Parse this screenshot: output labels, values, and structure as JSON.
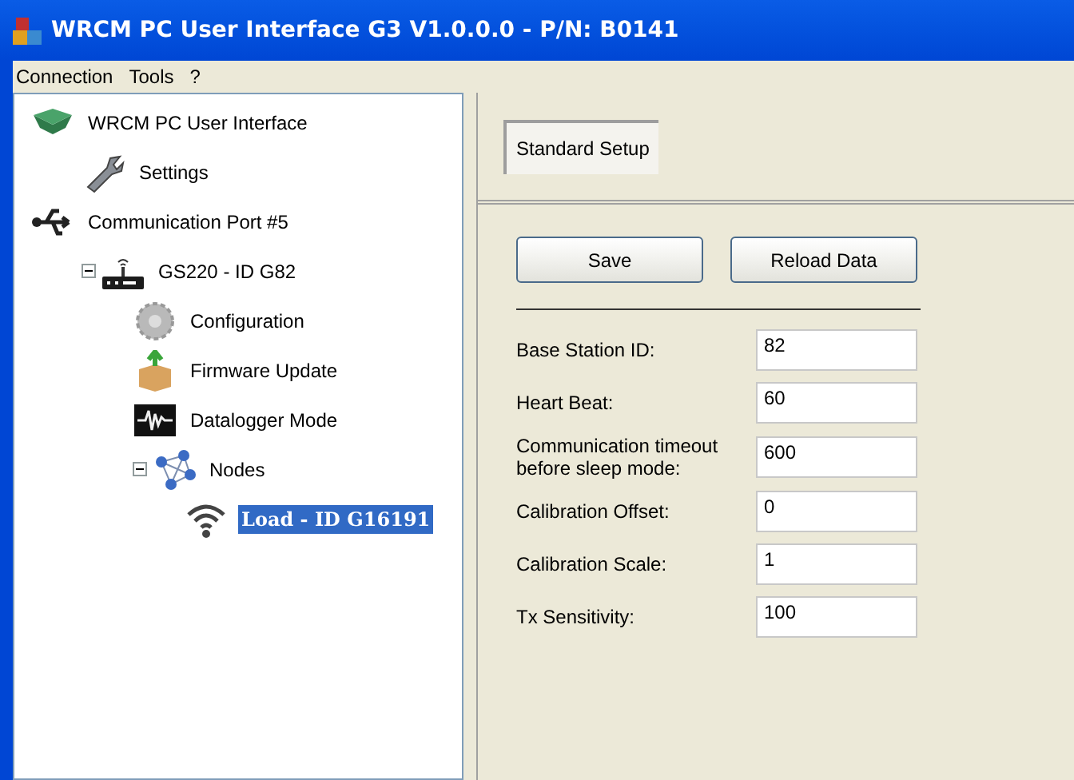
{
  "window": {
    "title": "WRCM PC User Interface G3 V1.0.0.0 - P/N: B0141"
  },
  "menu": [
    "Connection",
    "Tools",
    "?"
  ],
  "tree": [
    {
      "label": "WRCM PC User Interface",
      "kind": "app",
      "selected": false,
      "children": [
        {
          "label": "Settings",
          "kind": "wrench",
          "selected": false
        }
      ]
    },
    {
      "label": "Communication Port #5",
      "kind": "usb",
      "selected": false,
      "children": [
        {
          "label": "GS220 - ID G82",
          "kind": "router",
          "selected": false,
          "expanded": true,
          "children": [
            {
              "label": "Configuration",
              "kind": "gear",
              "selected": false
            },
            {
              "label": "Firmware Update",
              "kind": "box",
              "selected": false
            },
            {
              "label": "Datalogger Mode",
              "kind": "waveform",
              "selected": false
            },
            {
              "label": "Nodes",
              "kind": "network",
              "selected": false,
              "expanded": true,
              "children": [
                {
                  "label": "Load - ID G16191",
                  "kind": "wifi",
                  "selected": true
                }
              ]
            }
          ]
        }
      ]
    }
  ],
  "tabs": [
    {
      "label": "Standard Setup",
      "selected": true
    }
  ],
  "buttons": [
    "Save",
    "Reload Data"
  ],
  "fields": [
    {
      "label": "Base Station ID:",
      "value": "82"
    },
    {
      "label": "Heart Beat:",
      "value": "60"
    },
    {
      "label": "Communication timeout before sleep mode:",
      "value": "600"
    },
    {
      "label": "Calibration Offset:",
      "value": "0"
    },
    {
      "label": "Calibration Scale:",
      "value": "1"
    },
    {
      "label": "Tx Sensitivity:",
      "value": "100"
    }
  ]
}
